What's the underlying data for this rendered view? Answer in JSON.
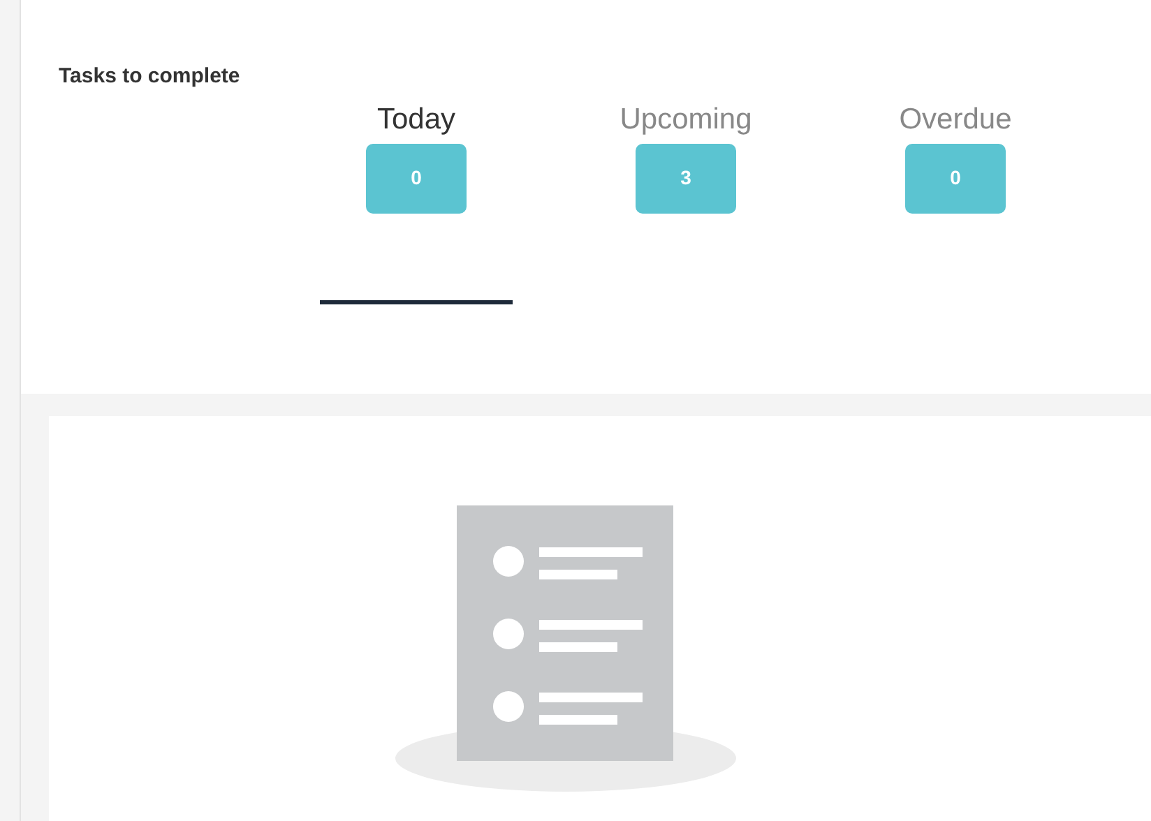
{
  "title": "Tasks to complete",
  "tabs": [
    {
      "label": "Today",
      "count": "0",
      "selected": true
    },
    {
      "label": "Upcoming",
      "count": "3",
      "selected": false
    },
    {
      "label": "Overdue",
      "count": "0",
      "selected": false
    }
  ]
}
